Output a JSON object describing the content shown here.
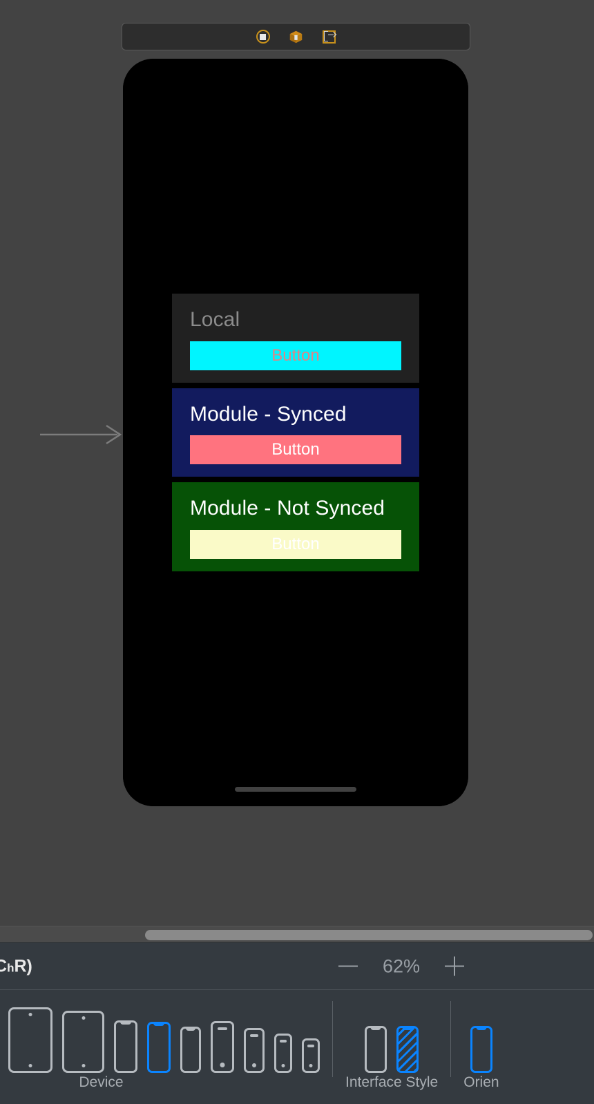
{
  "scene_toolbar": {
    "icons": [
      {
        "name": "view-controller-icon",
        "title": "View Controller"
      },
      {
        "name": "first-responder-cube-icon",
        "title": "First Responder"
      },
      {
        "name": "exit-icon",
        "title": "Exit"
      }
    ]
  },
  "canvas": {
    "segue_arrow": "entry-point-arrow"
  },
  "preview": {
    "cards": [
      {
        "id": "local",
        "title": "Local",
        "button_label": "Button",
        "background": "#212121",
        "title_color": "#8c8c8c",
        "button_background": "#00f5ff",
        "button_text_color": "#e08585"
      },
      {
        "id": "module-synced",
        "title": "Module - Synced",
        "button_label": "Button",
        "background": "#121b5e",
        "title_color": "#ffffff",
        "button_background": "#ff737f",
        "button_text_color": "#ffffff"
      },
      {
        "id": "module-not-synced",
        "title": "Module - Not Synced",
        "button_label": "Button",
        "background": "#065206",
        "title_color": "#ffffff",
        "button_background": "#fafac8",
        "button_text_color": "#ffffff"
      }
    ]
  },
  "statusbar": {
    "size_class_prefix": "C",
    "size_class_sub": "h",
    "size_class_suffix": "R)",
    "zoom_out_label": "minus-icon",
    "zoom_value": "62%",
    "zoom_in_label": "plus-icon"
  },
  "devicebar": {
    "device_label": "Device",
    "interface_style_label": "Interface Style",
    "orientation_label": "Orien",
    "devices": [
      {
        "name": "ipad-pro-partial",
        "selected": false
      },
      {
        "name": "ipad-large",
        "selected": false
      },
      {
        "name": "ipad-mini",
        "selected": false
      },
      {
        "name": "iphone-max",
        "selected": false
      },
      {
        "name": "iphone-notch-selected",
        "selected": true
      },
      {
        "name": "iphone-notch-small",
        "selected": false
      },
      {
        "name": "iphone-plus-home",
        "selected": false
      },
      {
        "name": "iphone-home",
        "selected": false
      },
      {
        "name": "iphone-se",
        "selected": false
      },
      {
        "name": "iphone-mini",
        "selected": false
      }
    ],
    "interface_styles": [
      {
        "name": "light-appearance",
        "selected": false
      },
      {
        "name": "dark-appearance",
        "selected": true
      }
    ],
    "orientations": [
      {
        "name": "portrait-orientation",
        "selected": true
      }
    ]
  }
}
